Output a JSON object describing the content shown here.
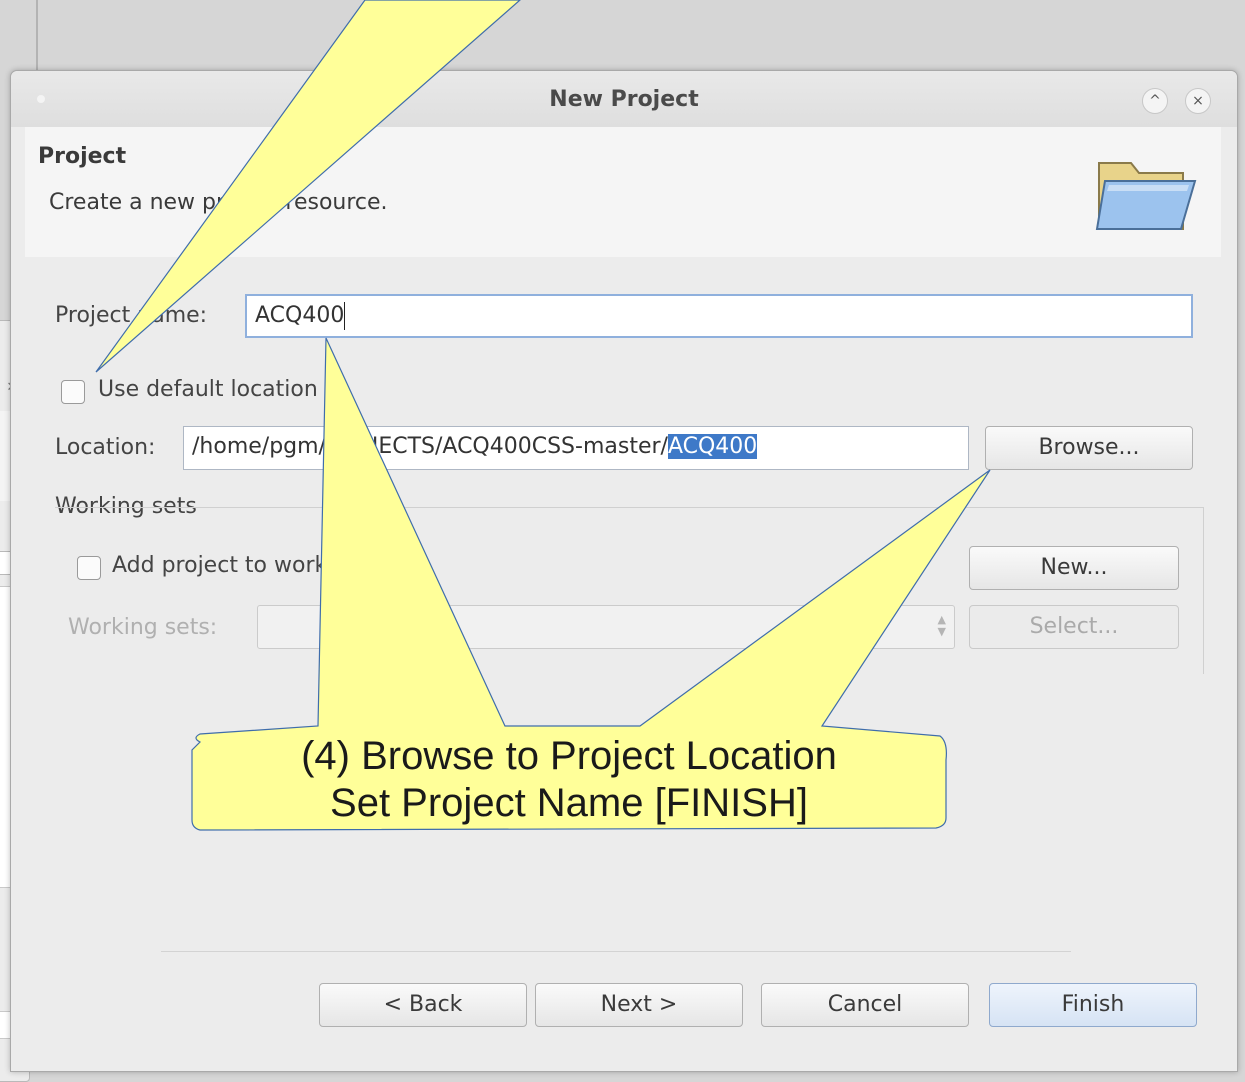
{
  "dialog": {
    "title": "New Project",
    "header": {
      "title": "Project",
      "description": "Create a new project resource.",
      "icon": "folder-open-icon"
    },
    "project_name": {
      "label": "Project name:",
      "value": "ACQ400"
    },
    "use_default_location": {
      "label": "Use default location",
      "checked": false
    },
    "location": {
      "label": "Location:",
      "value_prefix": "/home/pgm/PROJECTS/ACQ400CSS-master/",
      "value_selected": "ACQ400",
      "browse_label": "Browse..."
    },
    "working_sets": {
      "group_label": "Working sets",
      "add_label": "Add project to working sets",
      "add_checked": false,
      "new_label": "New...",
      "field_label": "Working sets:",
      "select_label": "Select..."
    },
    "buttons": {
      "back": "< Back",
      "next": "Next >",
      "cancel": "Cancel",
      "finish": "Finish"
    }
  },
  "callout": {
    "line1": "(4) Browse to Project Location",
    "line2": "Set Project Name  [FINISH]",
    "color": "#ffff99"
  }
}
